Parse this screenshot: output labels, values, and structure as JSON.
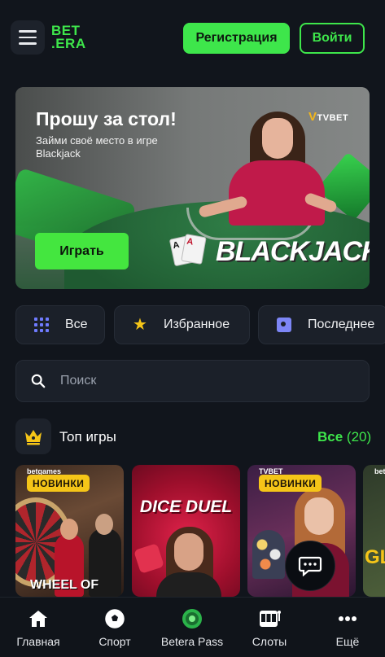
{
  "header": {
    "logo_line1": "BET",
    "logo_line2": ".ERA",
    "register_label": "Регистрация",
    "login_label": "Войти"
  },
  "banner": {
    "title": "Прошу за стол!",
    "subtitle": "Займи своё место в игре Blackjack",
    "play_label": "Играть",
    "provider": "TVBET",
    "game_logo": "BLACKJACK"
  },
  "filters": [
    {
      "label": "Все",
      "icon": "grid-icon"
    },
    {
      "label": "Избранное",
      "icon": "star-icon"
    },
    {
      "label": "Последнее",
      "icon": "recent-icon"
    }
  ],
  "search": {
    "placeholder": "Поиск"
  },
  "top_games": {
    "title": "Топ игры",
    "all_label": "Все",
    "count": "(20)",
    "new_badge": "НОВИНКИ",
    "tiles": [
      {
        "provider": "betgames",
        "title": "WHEEL OF",
        "badge": true
      },
      {
        "provider": "",
        "title": "DICE DUEL",
        "badge": false
      },
      {
        "provider": "TVBET",
        "title": "",
        "badge": true
      },
      {
        "provider": "betgames",
        "title": "GL",
        "badge": false
      }
    ]
  },
  "bottom_nav": [
    {
      "label": "Главная",
      "icon": "home-icon"
    },
    {
      "label": "Спорт",
      "icon": "soccer-ball-icon"
    },
    {
      "label": "Betera Pass",
      "icon": "pass-icon"
    },
    {
      "label": "Слоты",
      "icon": "slot-machine-icon"
    },
    {
      "label": "Ещё",
      "icon": "more-dots-icon"
    }
  ],
  "colors": {
    "background": "#11151c",
    "accent": "#3ee64b",
    "badge": "#f5c518",
    "card": "#1b2029"
  }
}
